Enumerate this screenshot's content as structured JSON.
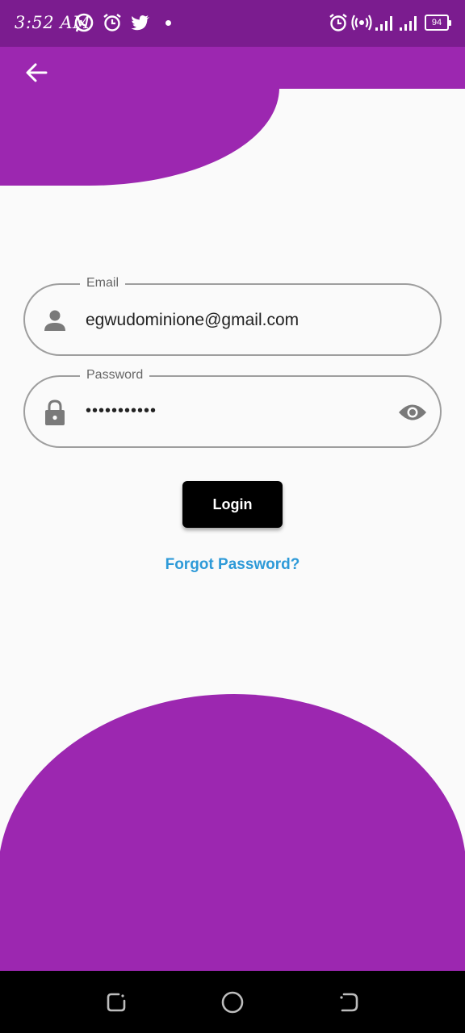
{
  "status_bar": {
    "time": "3:52 AM",
    "battery_level": "94",
    "background_color": "#7b1c8f",
    "icons": [
      "whatsapp-icon",
      "alarm-icon",
      "twitter-icon",
      "notification-dot-icon",
      "alarm-icon",
      "hotspot-icon",
      "signal-icon",
      "signal-icon",
      "battery-icon"
    ]
  },
  "header": {
    "back_icon": "arrow-left-icon",
    "accent_color": "#9c27b0"
  },
  "form": {
    "email": {
      "label": "Email",
      "value": "egwudominione@gmail.com",
      "icon": "person-icon"
    },
    "password": {
      "label": "Password",
      "masked_value": "•••••••••••",
      "icon": "lock-icon",
      "toggle_icon": "eye-icon"
    },
    "login_label": "Login",
    "forgot_label": "Forgot Password?",
    "link_color": "#2e9ad8"
  },
  "nav_bar": {
    "buttons": [
      "recent-apps-icon",
      "home-icon",
      "back-icon"
    ]
  }
}
